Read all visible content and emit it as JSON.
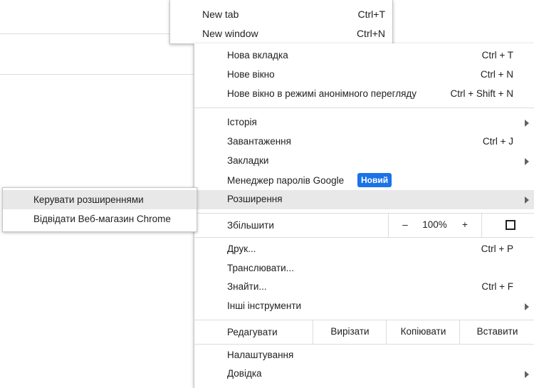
{
  "top_menu": {
    "items": [
      {
        "label": "New tab",
        "shortcut": "Ctrl+T"
      },
      {
        "label": "New window",
        "shortcut": "Ctrl+N"
      }
    ]
  },
  "main_menu": {
    "new_tab": {
      "label": "Нова вкладка",
      "shortcut": "Ctrl + T"
    },
    "new_window": {
      "label": "Нове вікно",
      "shortcut": "Ctrl + N"
    },
    "incognito": {
      "label": "Нове вікно в режимі анонімного перегляду",
      "shortcut": "Ctrl + Shift + N"
    },
    "history": {
      "label": "Історія"
    },
    "downloads": {
      "label": "Завантаження",
      "shortcut": "Ctrl + J"
    },
    "bookmarks": {
      "label": "Закладки"
    },
    "passwords": {
      "label": "Менеджер паролів Google",
      "badge": "Новий"
    },
    "extensions": {
      "label": "Розширення"
    },
    "zoom": {
      "label": "Збільшити",
      "minus": "–",
      "value": "100%",
      "plus": "+"
    },
    "print": {
      "label": "Друк...",
      "shortcut": "Ctrl + P"
    },
    "cast": {
      "label": "Транслювати..."
    },
    "find": {
      "label": "Знайти...",
      "shortcut": "Ctrl + F"
    },
    "more_tools": {
      "label": "Інші інструменти"
    },
    "edit": {
      "label": "Редагувати",
      "cut": "Вирізати",
      "copy": "Копіювати",
      "paste": "Вставити"
    },
    "settings": {
      "label": "Налаштування"
    },
    "help": {
      "label": "Довідка"
    }
  },
  "extensions_submenu": {
    "items": [
      {
        "label": "Керувати розширеннями"
      },
      {
        "label": "Відвідати Веб-магазин Chrome"
      }
    ]
  },
  "colors": {
    "badge": "#1a73e8",
    "highlight": "#e8e8e8"
  }
}
